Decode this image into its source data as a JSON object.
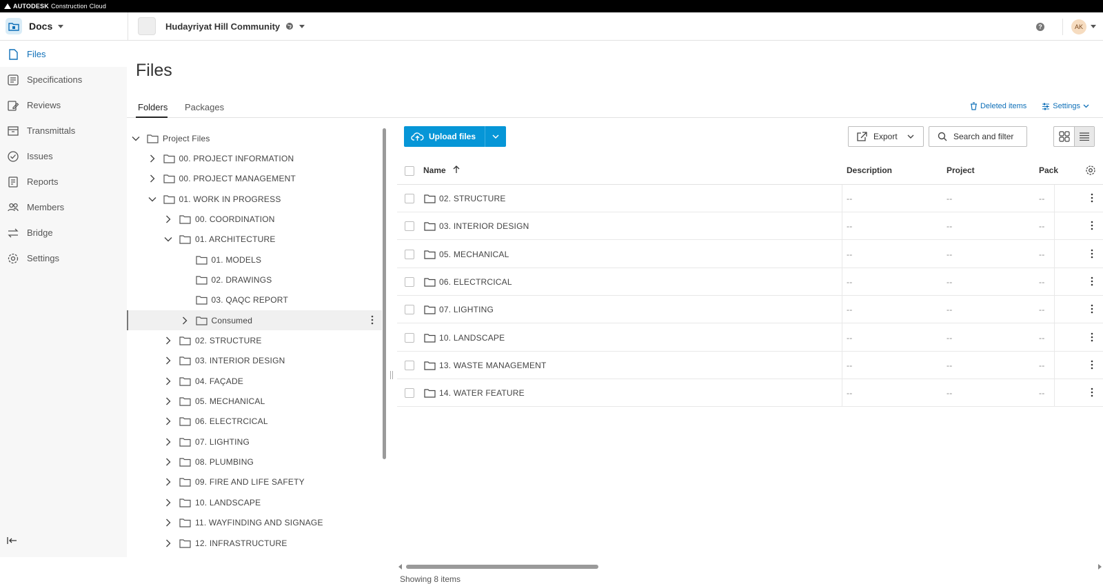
{
  "brand": {
    "company": "AUTODESK",
    "product": "Construction Cloud"
  },
  "header": {
    "app_name": "Docs",
    "project_name": "Hudayriyat Hill Community",
    "help_label": "?",
    "avatar_initials": "AK"
  },
  "leftnav": {
    "items": [
      {
        "label": "Files",
        "icon": "file-icon",
        "active": true
      },
      {
        "label": "Specifications",
        "icon": "specifications-icon"
      },
      {
        "label": "Reviews",
        "icon": "reviews-icon"
      },
      {
        "label": "Transmittals",
        "icon": "transmittals-icon"
      },
      {
        "label": "Issues",
        "icon": "issues-icon"
      },
      {
        "label": "Reports",
        "icon": "reports-icon"
      },
      {
        "label": "Members",
        "icon": "members-icon"
      },
      {
        "label": "Bridge",
        "icon": "bridge-icon"
      },
      {
        "label": "Settings",
        "icon": "settings-icon"
      }
    ]
  },
  "page": {
    "title": "Files"
  },
  "tabs": {
    "folders": "Folders",
    "packages": "Packages",
    "deleted_items": "Deleted items",
    "settings": "Settings"
  },
  "tree": {
    "rows": [
      {
        "label": "Project Files",
        "chevron": "down"
      },
      {
        "label": "00. PROJECT INFORMATION",
        "chevron": "right"
      },
      {
        "label": "00. PROJECT MANAGEMENT",
        "chevron": "right"
      },
      {
        "label": "01. WORK IN PROGRESS",
        "chevron": "down"
      },
      {
        "label": "00. COORDINATION",
        "chevron": "right"
      },
      {
        "label": "01. ARCHITECTURE",
        "chevron": "down"
      },
      {
        "label": "01. MODELS",
        "chevron": "none"
      },
      {
        "label": "02. DRAWINGS",
        "chevron": "none"
      },
      {
        "label": "03. QAQC REPORT",
        "chevron": "none"
      },
      {
        "label": "Consumed",
        "chevron": "right",
        "selected": true
      },
      {
        "label": "02. STRUCTURE",
        "chevron": "right"
      },
      {
        "label": "03. INTERIOR DESIGN",
        "chevron": "right"
      },
      {
        "label": "04. FAÇADE",
        "chevron": "right"
      },
      {
        "label": "05. MECHANICAL",
        "chevron": "right"
      },
      {
        "label": "06. ELECTRCICAL",
        "chevron": "right"
      },
      {
        "label": "07. LIGHTING",
        "chevron": "right"
      },
      {
        "label": "08. PLUMBING",
        "chevron": "right"
      },
      {
        "label": "09. FIRE AND LIFE SAFETY",
        "chevron": "right"
      },
      {
        "label": "10. LANDSCAPE",
        "chevron": "right"
      },
      {
        "label": "11. WAYFINDING AND SIGNAGE",
        "chevron": "right"
      },
      {
        "label": "12. INFRASTRUCTURE",
        "chevron": "right"
      }
    ]
  },
  "toolbar": {
    "upload_label": "Upload files",
    "export_label": "Export",
    "search_label": "Search and filter"
  },
  "table": {
    "columns": {
      "name": "Name",
      "description": "Description",
      "project": "Project",
      "package": "Pack"
    },
    "rows": [
      {
        "name": "02. STRUCTURE",
        "description": "--",
        "project": "--",
        "package": "--"
      },
      {
        "name": "03. INTERIOR DESIGN",
        "description": "--",
        "project": "--",
        "package": "--"
      },
      {
        "name": "05. MECHANICAL",
        "description": "--",
        "project": "--",
        "package": "--"
      },
      {
        "name": "06. ELECTRCICAL",
        "description": "--",
        "project": "--",
        "package": "--"
      },
      {
        "name": "07. LIGHTING",
        "description": "--",
        "project": "--",
        "package": "--"
      },
      {
        "name": "10. LANDSCAPE",
        "description": "--",
        "project": "--",
        "package": "--"
      },
      {
        "name": "13. WASTE MANAGEMENT",
        "description": "--",
        "project": "--",
        "package": "--"
      },
      {
        "name": "14. WATER FEATURE",
        "description": "--",
        "project": "--",
        "package": "--"
      }
    ],
    "footer": "Showing 8 items"
  },
  "colors": {
    "accent": "#0696d7",
    "link": "#0d6fb8",
    "topbar": "#000000"
  }
}
